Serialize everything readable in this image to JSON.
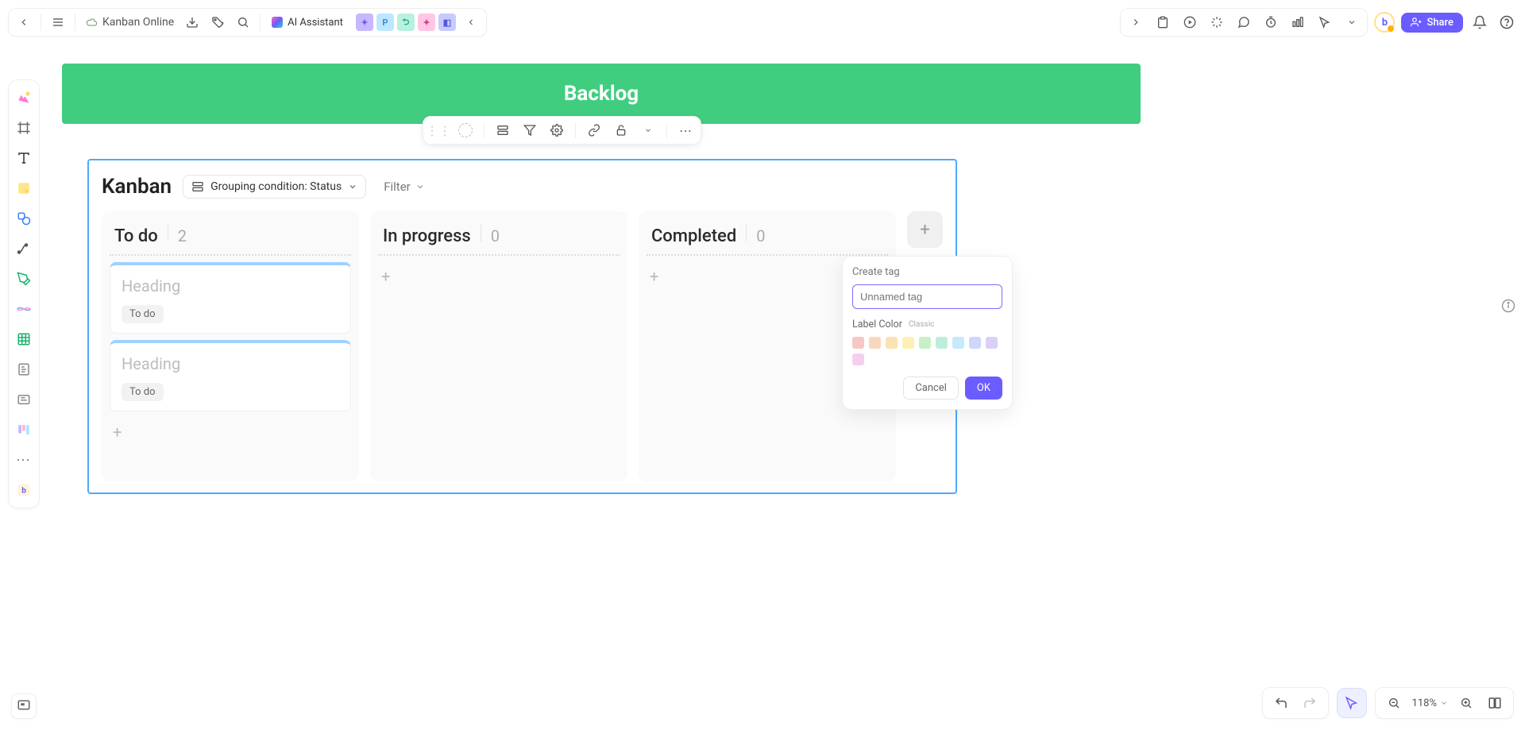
{
  "header": {
    "doc_title": "Kanban Online",
    "ai_label": "AI Assistant",
    "share_label": "Share",
    "avatars": [
      "✦",
      "P",
      "⮌",
      "✦",
      "◧"
    ]
  },
  "banner": {
    "title": "Backlog"
  },
  "board": {
    "title": "Kanban",
    "grouping_label": "Grouping condition: Status",
    "filter_label": "Filter",
    "columns": [
      {
        "title": "To do",
        "count": "2",
        "cards": [
          {
            "heading": "Heading",
            "tag": "To do"
          },
          {
            "heading": "Heading",
            "tag": "To do"
          }
        ]
      },
      {
        "title": "In progress",
        "count": "0",
        "cards": []
      },
      {
        "title": "Completed",
        "count": "0",
        "cards": []
      }
    ]
  },
  "popover": {
    "title": "Create tag",
    "placeholder": "Unnamed tag",
    "label_color": "Label Color",
    "label_color_sub": "Classic",
    "colors": [
      "#f6c7c4",
      "#f9d7bf",
      "#fbe2b2",
      "#fdf0b2",
      "#c9efc9",
      "#bdeedd",
      "#c6e9fb",
      "#cdd8fb",
      "#dacffb",
      "#f6cfef"
    ],
    "cancel": "Cancel",
    "ok": "OK"
  },
  "zoom": {
    "value": "118%"
  }
}
